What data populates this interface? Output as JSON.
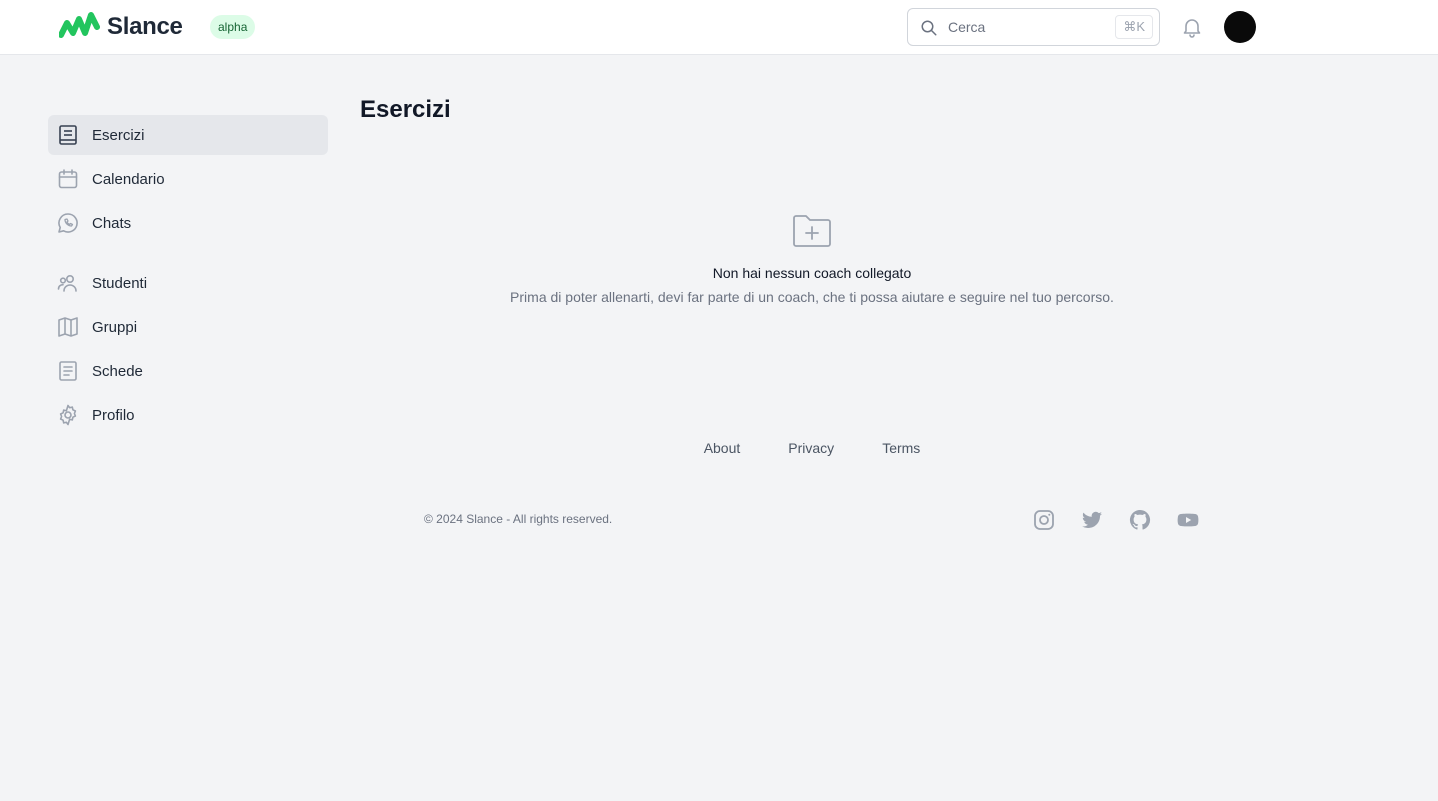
{
  "header": {
    "brand": "Slance",
    "badge": "alpha",
    "search": {
      "placeholder": "Cerca",
      "shortcut": "⌘K"
    }
  },
  "sidebar": {
    "items": [
      {
        "label": "Esercizi",
        "icon": "book-icon",
        "active": true
      },
      {
        "label": "Calendario",
        "icon": "calendar-icon"
      },
      {
        "label": "Chats",
        "icon": "whatsapp-icon"
      },
      {
        "label": "Studenti",
        "icon": "users-icon"
      },
      {
        "label": "Gruppi",
        "icon": "map-icon"
      },
      {
        "label": "Schede",
        "icon": "document-icon"
      },
      {
        "label": "Profilo",
        "icon": "gear-icon"
      }
    ]
  },
  "main": {
    "title": "Esercizi",
    "empty": {
      "icon": "folder-plus-icon",
      "title": "Non hai nessun coach collegato",
      "description": "Prima di poter allenarti, devi far parte di un coach, che ti possa aiutare e seguire nel tuo percorso."
    }
  },
  "footer": {
    "links": [
      "About",
      "Privacy",
      "Terms"
    ],
    "copyright": "© 2024 Slance - All rights reserved.",
    "socials": [
      "instagram-icon",
      "twitter-icon",
      "github-icon",
      "youtube-icon"
    ]
  },
  "colors": {
    "brand": "#22c55e",
    "badge_bg": "#dcfce7",
    "badge_text": "#166534"
  }
}
